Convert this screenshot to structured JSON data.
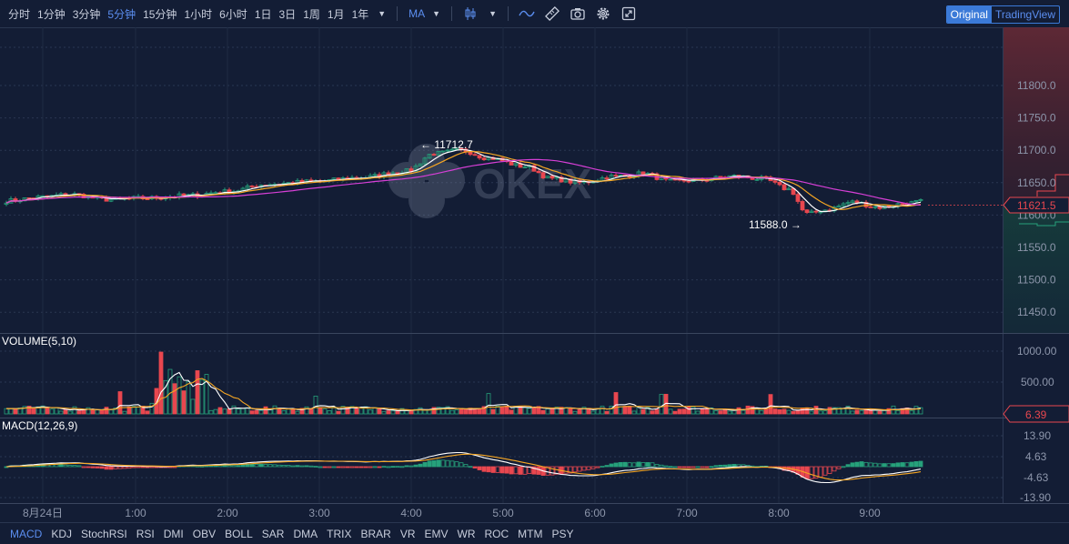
{
  "toolbar": {
    "timeframes": [
      "分时",
      "1分钟",
      "3分钟",
      "5分钟",
      "15分钟",
      "1小时",
      "6小时",
      "1日",
      "3日",
      "1周",
      "1月",
      "1年"
    ],
    "active_timeframe": "5分钟",
    "indicator_label": "MA",
    "view_original": "Original",
    "view_tradingview": "TradingView",
    "icons": [
      "caret-down-icon",
      "candle-type-icon",
      "caret-down-icon",
      "line-style-icon",
      "ruler-icon",
      "camera-icon",
      "gear-icon",
      "fullscreen-icon"
    ]
  },
  "main_chart": {
    "price_ticks": [
      "11800.0",
      "11750.0",
      "11700.0",
      "11650.0",
      "11600.0",
      "11550.0",
      "11500.0",
      "11450.0"
    ],
    "current_price": "11621.5",
    "high_label": "← 11712.7",
    "low_label": "11588.0 →",
    "watermark": "OKEX"
  },
  "volume_panel": {
    "title": "VOLUME(5,10)",
    "ticks": [
      "1000.00",
      "500.00"
    ],
    "current": "6.39"
  },
  "macd_panel": {
    "title": "MACD(12,26,9)",
    "ticks": [
      "13.90",
      "4.63",
      "-4.63",
      "-13.90"
    ]
  },
  "time_axis": {
    "labels": [
      "8月24日",
      "1:00",
      "2:00",
      "3:00",
      "4:00",
      "5:00",
      "6:00",
      "7:00",
      "8:00",
      "9:00"
    ]
  },
  "indicators": {
    "items": [
      "MACD",
      "KDJ",
      "StochRSI",
      "RSI",
      "DMI",
      "OBV",
      "BOLL",
      "SAR",
      "DMA",
      "TRIX",
      "BRAR",
      "VR",
      "EMV",
      "WR",
      "ROC",
      "MTM",
      "PSY"
    ],
    "active": "MACD"
  },
  "colors": {
    "up": "#26a17b",
    "down": "#e8474f",
    "ma_white": "#ffffff",
    "ma_orange": "#f5a623",
    "ma_magenta": "#d63fd6",
    "accent": "#5b8ef0",
    "background": "#131d35"
  }
}
